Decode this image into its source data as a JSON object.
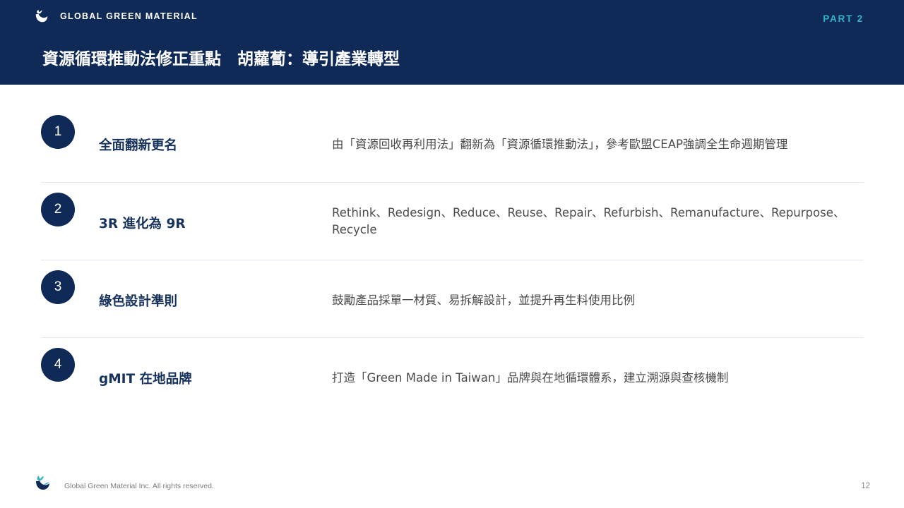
{
  "header": {
    "brand": "GLOBAL GREEN MATERIAL",
    "part": "PART 2",
    "title": "資源循環推動法修正重點　胡蘿蔔：導引產業轉型"
  },
  "items": [
    {
      "number": "1",
      "title": "全面翻新更名",
      "desc": "由「資源回收再利用法」翻新為「資源循環推動法」，參考歐盟CEAP強調全生命週期管理"
    },
    {
      "number": "2",
      "title": "3R 進化為 9R",
      "desc": "Rethink、Redesign、Reduce、Reuse、Repair、Refurbish、Remanufacture、Repurpose、Recycle"
    },
    {
      "number": "3",
      "title": "綠色設計準則",
      "desc": "鼓勵產品採單一材質、易拆解設計，並提升再生料使用比例"
    },
    {
      "number": "4",
      "title": "gMIT 在地品牌",
      "desc": "打造「Green Made in Taiwan」品牌與在地循環體系，建立溯源與查核機制"
    }
  ],
  "footer": {
    "copyright": "Global Green Material Inc. All rights reserved.",
    "page": "12"
  },
  "colors": {
    "navy": "#0f2a57",
    "accent": "#30b3c7",
    "divider": "#e4e8ee"
  }
}
